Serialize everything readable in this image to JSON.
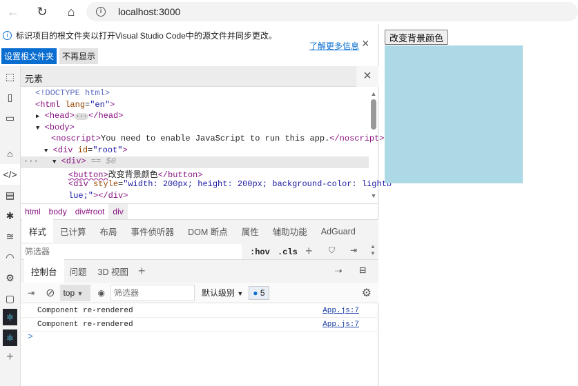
{
  "browser": {
    "url": "localhost:3000"
  },
  "infobar": {
    "message": "标识项目的根文件夹以打开Visual Studio Code中的源文件并同步更改。",
    "learn_more": "了解更多信息",
    "set_root": "设置根文件夹",
    "dont_show": "不再显示"
  },
  "elements": {
    "title": "元素",
    "tree": {
      "doctype": "<!DOCTYPE html>",
      "html_open": "<html",
      "html_attr": "lang",
      "html_val": "\"en\"",
      "head": "<head>",
      "head_close": "</head>",
      "body": "<body>",
      "noscript_open": "<noscript>",
      "noscript_text": "You need to enable JavaScript to run this app.",
      "noscript_close": "</noscript>",
      "div_root_open": "<div",
      "div_root_attr": "id",
      "div_root_val": "\"root\"",
      "div_sel": "<div>",
      "div_sel_suffix": "== $0",
      "button_open": "<button>",
      "button_text": "改变背景颜色",
      "button_close": "</button>",
      "div_style_open": "<div",
      "div_style_attr": "style",
      "div_style_val1": "\"width: 200px; height: 200px; background-color: lightb",
      "div_style_val2": "lue;\"",
      "div_style_close": "></div>"
    },
    "breadcrumb": [
      "html",
      "body",
      "div#root",
      "div"
    ]
  },
  "styles": {
    "tabs": [
      "样式",
      "已计算",
      "布局",
      "事件侦听器",
      "DOM 断点",
      "属性",
      "辅助功能",
      "AdGuard"
    ],
    "filter_placeholder": "筛选器",
    "hov": ":hov",
    "cls": ".cls"
  },
  "drawer": {
    "tabs": [
      "控制台",
      "问题",
      "3D 视图"
    ]
  },
  "console": {
    "context": "top",
    "filter_placeholder": "筛选器",
    "level": "默认级别",
    "message_count": "5",
    "messages": [
      {
        "text": "Component re-rendered",
        "source": "App.js:7"
      },
      {
        "text": "Component re-rendered",
        "source": "App.js:7"
      }
    ],
    "prompt": ">"
  },
  "page": {
    "button": "改变背景颜色",
    "box_color": "#add8e6"
  }
}
